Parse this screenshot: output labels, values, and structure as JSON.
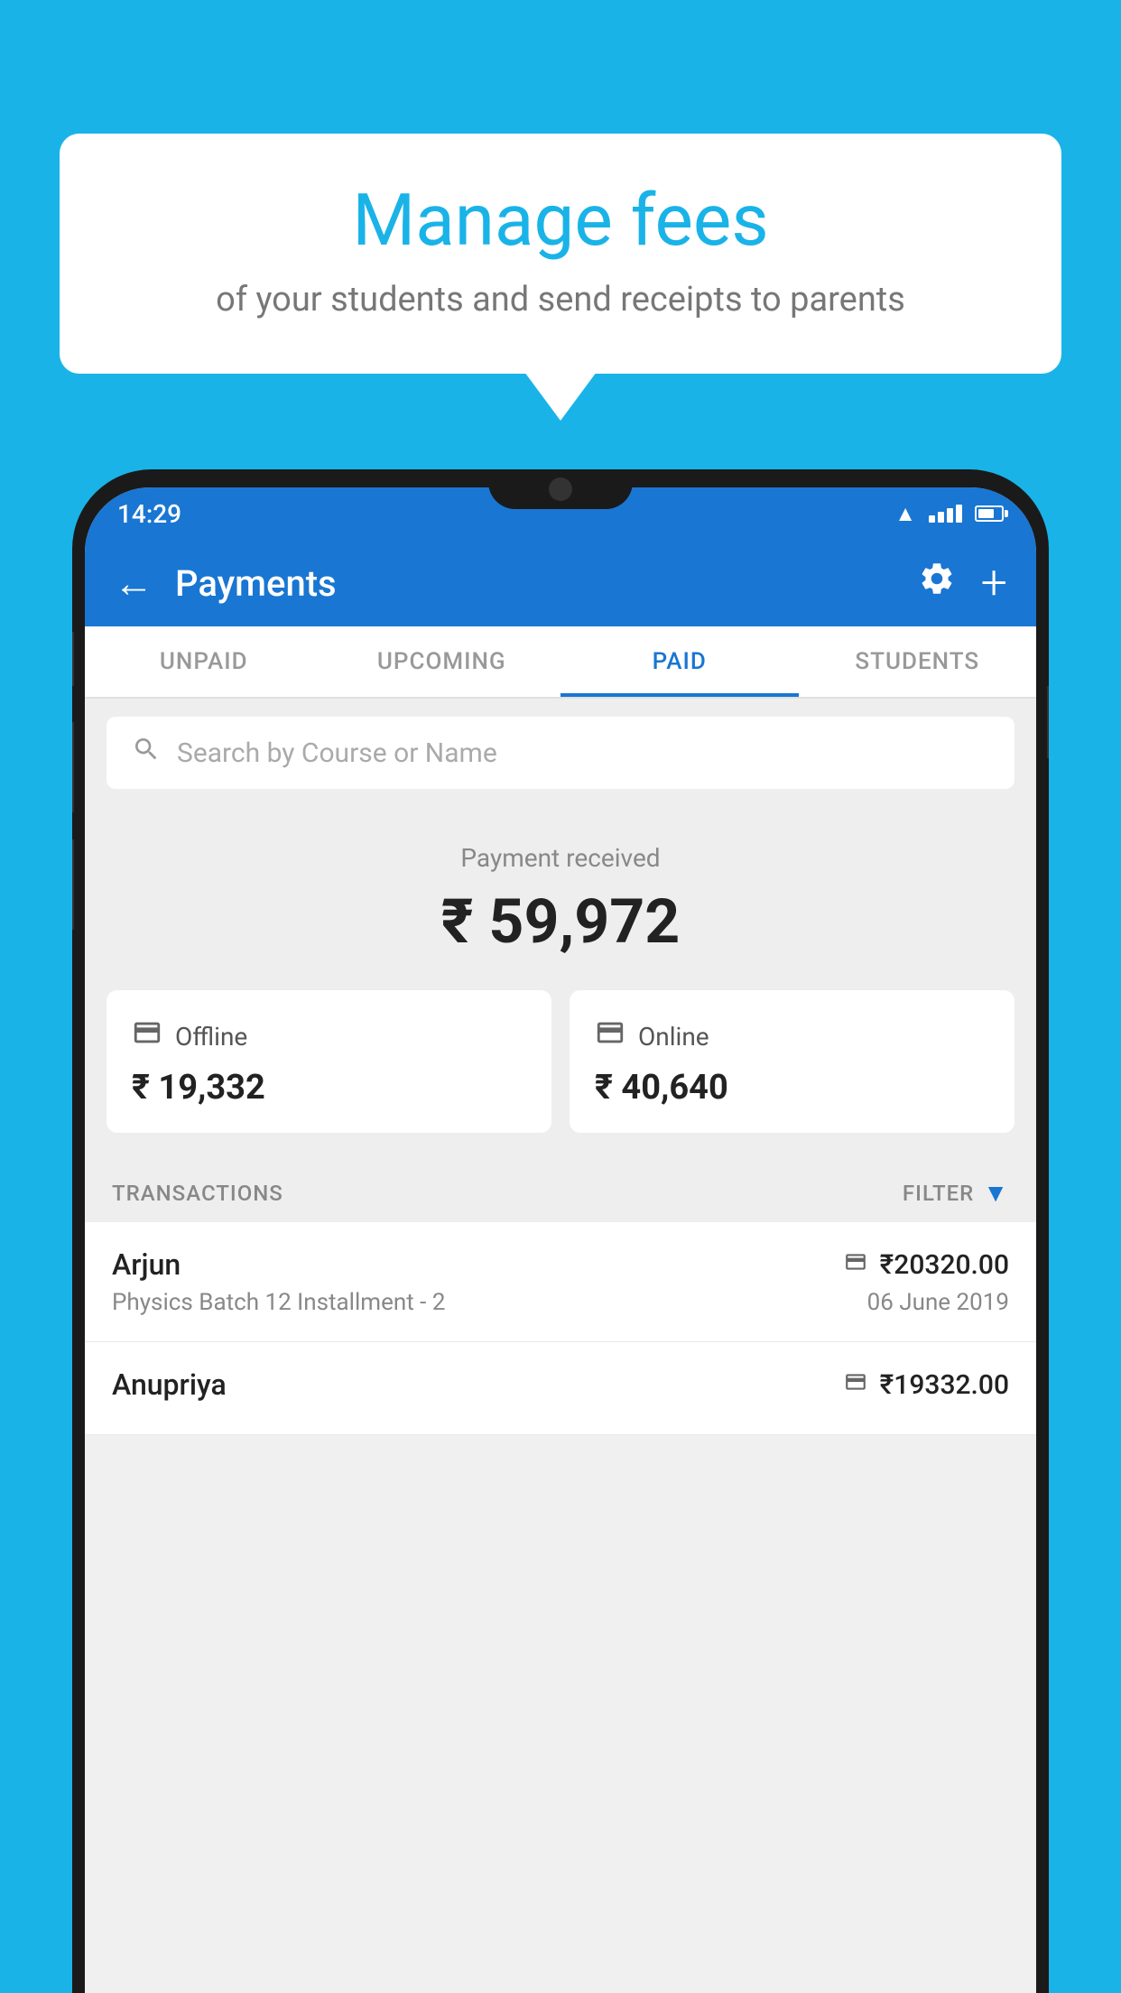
{
  "background_color": "#1ab3e8",
  "bubble": {
    "title": "Manage fees",
    "subtitle": "of your students and send receipts to parents"
  },
  "status_bar": {
    "time": "14:29",
    "icons": [
      "wifi",
      "signal",
      "battery"
    ]
  },
  "header": {
    "title": "Payments",
    "back_label": "←",
    "settings_label": "⚙",
    "add_label": "+"
  },
  "tabs": [
    {
      "label": "UNPAID",
      "active": false
    },
    {
      "label": "UPCOMING",
      "active": false
    },
    {
      "label": "PAID",
      "active": true
    },
    {
      "label": "STUDENTS",
      "active": false
    }
  ],
  "search": {
    "placeholder": "Search by Course or Name"
  },
  "payment_received": {
    "label": "Payment received",
    "amount": "₹ 59,972"
  },
  "payment_cards": [
    {
      "type": "Offline",
      "amount": "₹ 19,332",
      "icon": "offline"
    },
    {
      "type": "Online",
      "amount": "₹ 40,640",
      "icon": "online"
    }
  ],
  "transactions_section": {
    "label": "TRANSACTIONS",
    "filter_label": "FILTER"
  },
  "transactions": [
    {
      "name": "Arjun",
      "course": "Physics Batch 12 Installment - 2",
      "amount": "₹20320.00",
      "date": "06 June 2019",
      "payment_type": "online"
    },
    {
      "name": "Anupriya",
      "course": "",
      "amount": "₹19332.00",
      "date": "",
      "payment_type": "offline"
    }
  ]
}
